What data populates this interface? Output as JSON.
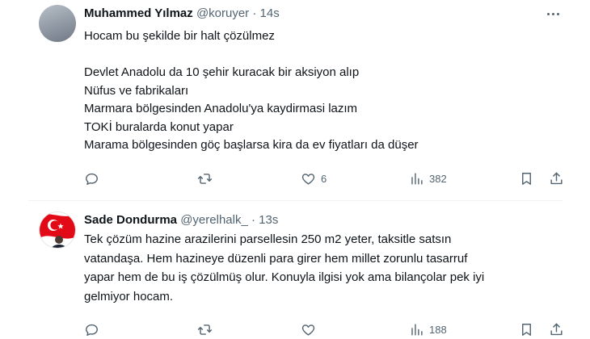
{
  "tweets": [
    {
      "name": "Muhammed Yılmaz",
      "handle": "@koruyer",
      "sep": "·",
      "time": "14s",
      "lines": [
        "Hocam bu şekilde bir halt çözülmez",
        "",
        "Devlet Anadolu da 10 şehir kuracak bir aksiyon alıp",
        "Nüfus ve fabrikaları",
        "Marmara bölgesinden Anadolu'ya kaydirmasi lazım",
        "TOKİ buralarda konut yapar",
        "Marama bölgesinden göç başlarsa kira da ev fiyatları da düşer"
      ],
      "likes": "6",
      "views": "382"
    },
    {
      "name": "Sade Dondurma",
      "handle": "@yerelhalk_",
      "sep": "·",
      "time": "13s",
      "lines": [
        "Tek çözüm hazine arazilerini parsellesin 250 m2 yeter, taksitle satsın",
        "vatandaşa. Hem hazineye düzenli para girer hem millet zorunlu tasarruf",
        "yapar hem de bu iş çözülmüş olur. Konuyla ilgisi yok ama bilançolar pek iyi",
        "gelmiyor hocam."
      ],
      "views": "188"
    }
  ],
  "icons": {
    "reply": "reply-icon",
    "retweet": "retweet-icon",
    "like": "heart-icon",
    "views": "views-icon",
    "bookmark": "bookmark-icon",
    "share": "share-icon",
    "more": "more-icon"
  },
  "colors": {
    "text": "#0f1419",
    "secondary": "#536471",
    "divider": "#eff3f4",
    "flag_red": "#e30a17"
  }
}
